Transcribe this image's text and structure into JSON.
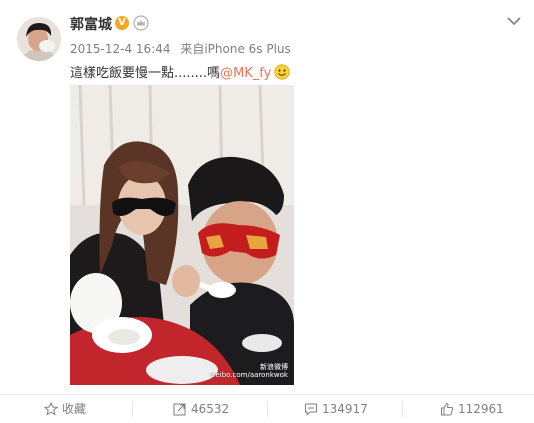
{
  "post": {
    "username": "郭富城",
    "verified_badge": "V",
    "timestamp": "2015-12-4 16:44",
    "source_prefix": "来自",
    "source_device": "iPhone 6s Plus",
    "text": "這樣吃飯要慢一點........嗎",
    "mention": "@MK_fy",
    "image_watermark_line1": "新浪微博",
    "image_watermark_line2": "weibo.com/aaronkwok"
  },
  "actions": {
    "favorite_label": "收藏",
    "repost_count": "46532",
    "comment_count": "134917",
    "like_count": "112961"
  },
  "colors": {
    "mention": "#eb7350",
    "badge": "#f5a623",
    "muted_text": "#808080"
  },
  "icons": [
    "crown-icon",
    "chevron-down-icon",
    "smiley-icon",
    "star-icon",
    "repost-icon",
    "comment-icon",
    "thumbs-up-icon"
  ]
}
